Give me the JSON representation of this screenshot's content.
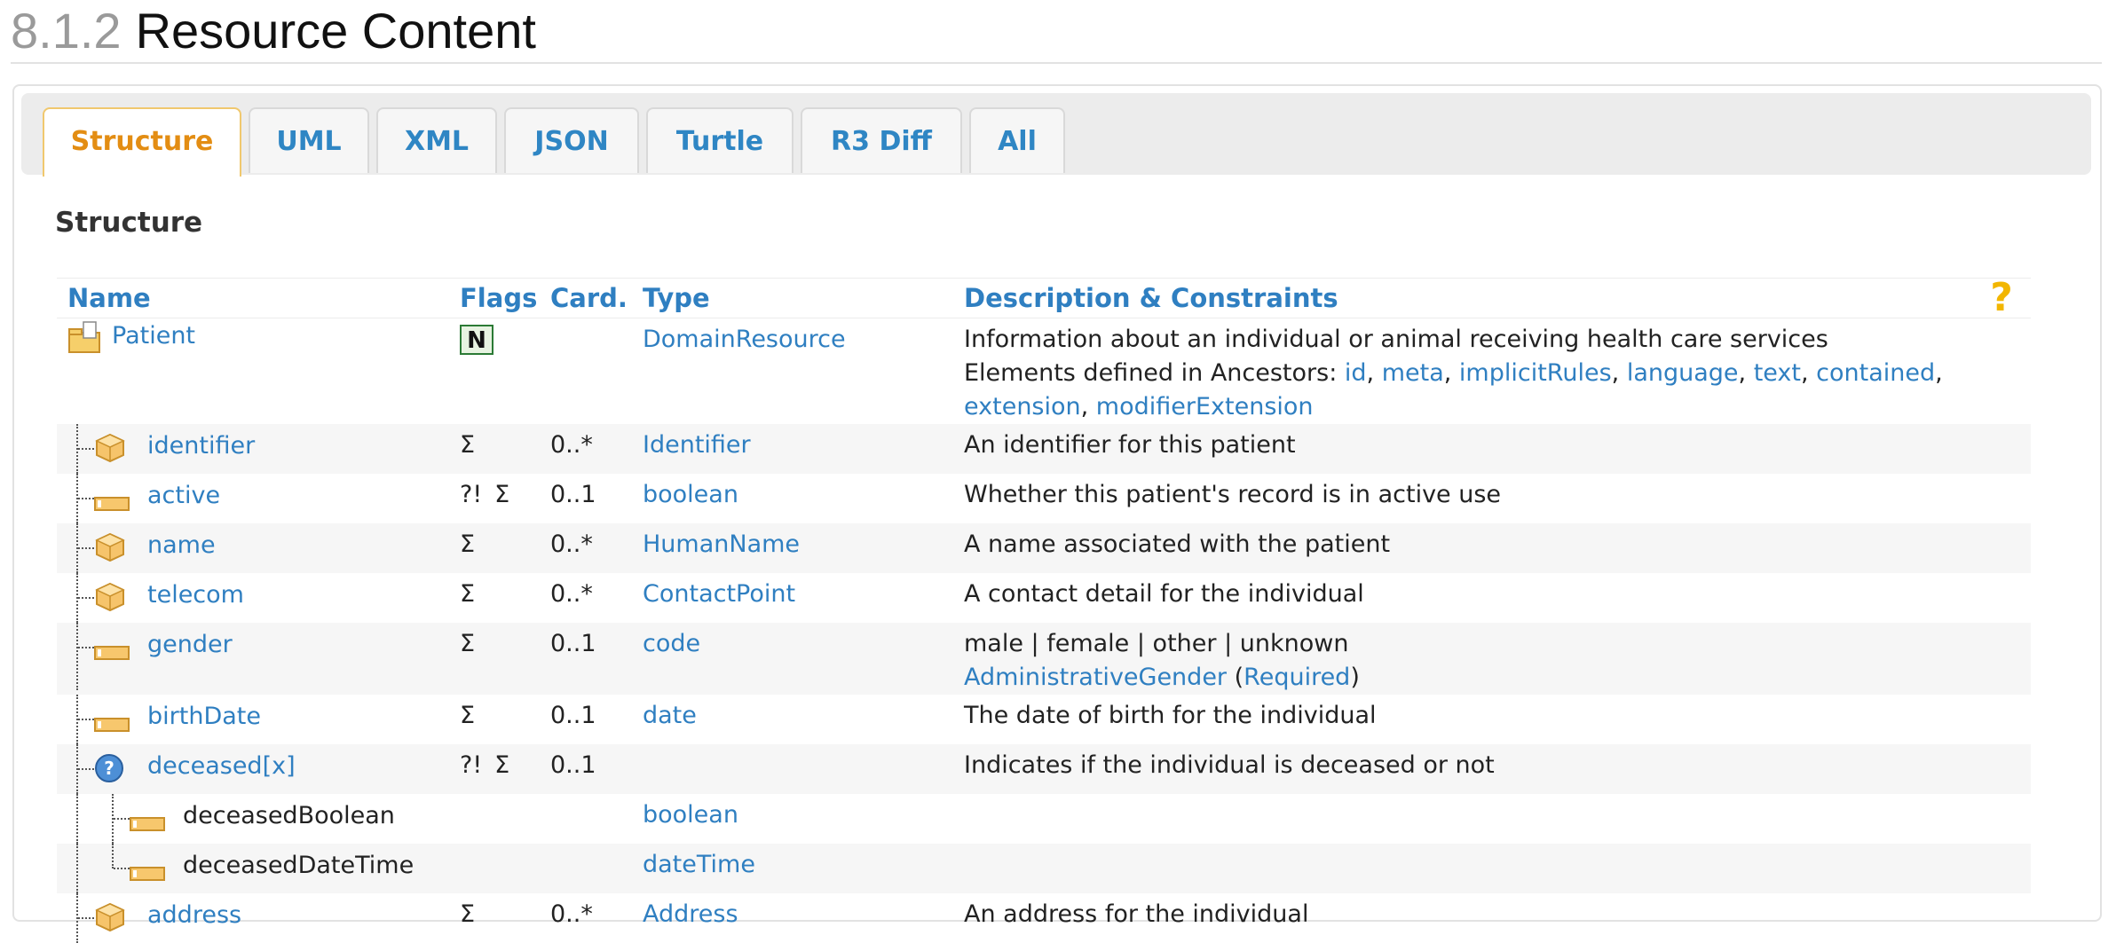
{
  "heading": {
    "number": "8.1.2",
    "title": "Resource Content"
  },
  "tabs": [
    "Structure",
    "UML",
    "XML",
    "JSON",
    "Turtle",
    "R3 Diff",
    "All"
  ],
  "active_tab": "Structure",
  "section_title": "Structure",
  "columns": {
    "name": "Name",
    "flags": "Flags",
    "card": "Card.",
    "type": "Type",
    "desc": "Description & Constraints",
    "help": "?"
  },
  "root": {
    "name": "Patient",
    "flag": "N",
    "type": "DomainResource",
    "desc_line1": "Information about an individual or animal receiving health care services",
    "ancestors_label": "Elements defined in Ancestors: ",
    "ancestors": [
      "id",
      "meta",
      "implicitRules",
      "language",
      "text",
      "contained",
      "extension",
      "modifierExtension"
    ]
  },
  "rows": [
    {
      "name": "identifier",
      "icon": "datatype-icon",
      "flags": [
        "Σ"
      ],
      "card": "0..*",
      "type": "Identifier",
      "desc": "An identifier for this patient"
    },
    {
      "name": "active",
      "icon": "primitive-icon",
      "flags": [
        "?!",
        "Σ"
      ],
      "card": "0..1",
      "type": "boolean",
      "desc": "Whether this patient's record is in active use"
    },
    {
      "name": "name",
      "icon": "datatype-icon",
      "flags": [
        "Σ"
      ],
      "card": "0..*",
      "type": "HumanName",
      "desc": "A name associated with the patient"
    },
    {
      "name": "telecom",
      "icon": "datatype-icon",
      "flags": [
        "Σ"
      ],
      "card": "0..*",
      "type": "ContactPoint",
      "desc": "A contact detail for the individual"
    },
    {
      "name": "gender",
      "icon": "primitive-icon",
      "flags": [
        "Σ"
      ],
      "card": "0..1",
      "type": "code",
      "desc": "male | female | other | unknown",
      "binding": "AdministrativeGender",
      "strength": "Required"
    },
    {
      "name": "birthDate",
      "icon": "primitive-icon",
      "flags": [
        "Σ"
      ],
      "card": "0..1",
      "type": "date",
      "desc": "The date of birth for the individual"
    },
    {
      "name": "deceased[x]",
      "icon": "choice-icon",
      "flags": [
        "?!",
        "Σ"
      ],
      "card": "0..1",
      "type": "",
      "desc": "Indicates if the individual is deceased or not"
    },
    {
      "name": "deceasedBoolean",
      "icon": "primitive-icon",
      "child": true,
      "flags": [],
      "card": "",
      "type": "boolean",
      "desc": ""
    },
    {
      "name": "deceasedDateTime",
      "icon": "primitive-icon",
      "child": true,
      "flags": [],
      "card": "",
      "type": "dateTime",
      "desc": ""
    },
    {
      "name": "address",
      "icon": "datatype-icon",
      "flags": [
        "Σ"
      ],
      "card": "0..*",
      "type": "Address",
      "desc": "An address for the individual"
    }
  ]
}
